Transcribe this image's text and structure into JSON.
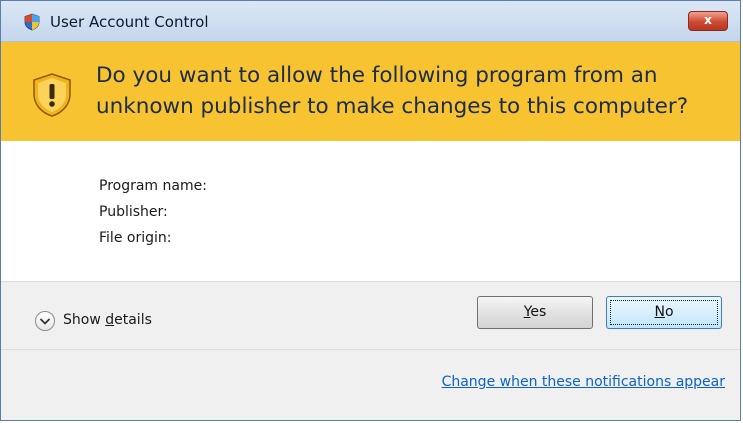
{
  "window": {
    "title": "User Account Control",
    "close_label": "x"
  },
  "banner": {
    "question": "Do you want to allow the following program from an unknown publisher to make changes to this computer?"
  },
  "info": {
    "program_name_label": "Program name:",
    "publisher_label": "Publisher:",
    "file_origin_label": "File origin:"
  },
  "footer": {
    "details": {
      "prefix": "Show ",
      "accel": "d",
      "suffix": "etails"
    },
    "yes_button": {
      "accel": "Y",
      "rest": "es"
    },
    "no_button": {
      "accel": "N",
      "rest": "o"
    },
    "change_link": "Change when these notifications appear"
  },
  "colors": {
    "banner": "#f8c330",
    "link": "#0d63c2",
    "titlebar": "#c5d6ec"
  }
}
